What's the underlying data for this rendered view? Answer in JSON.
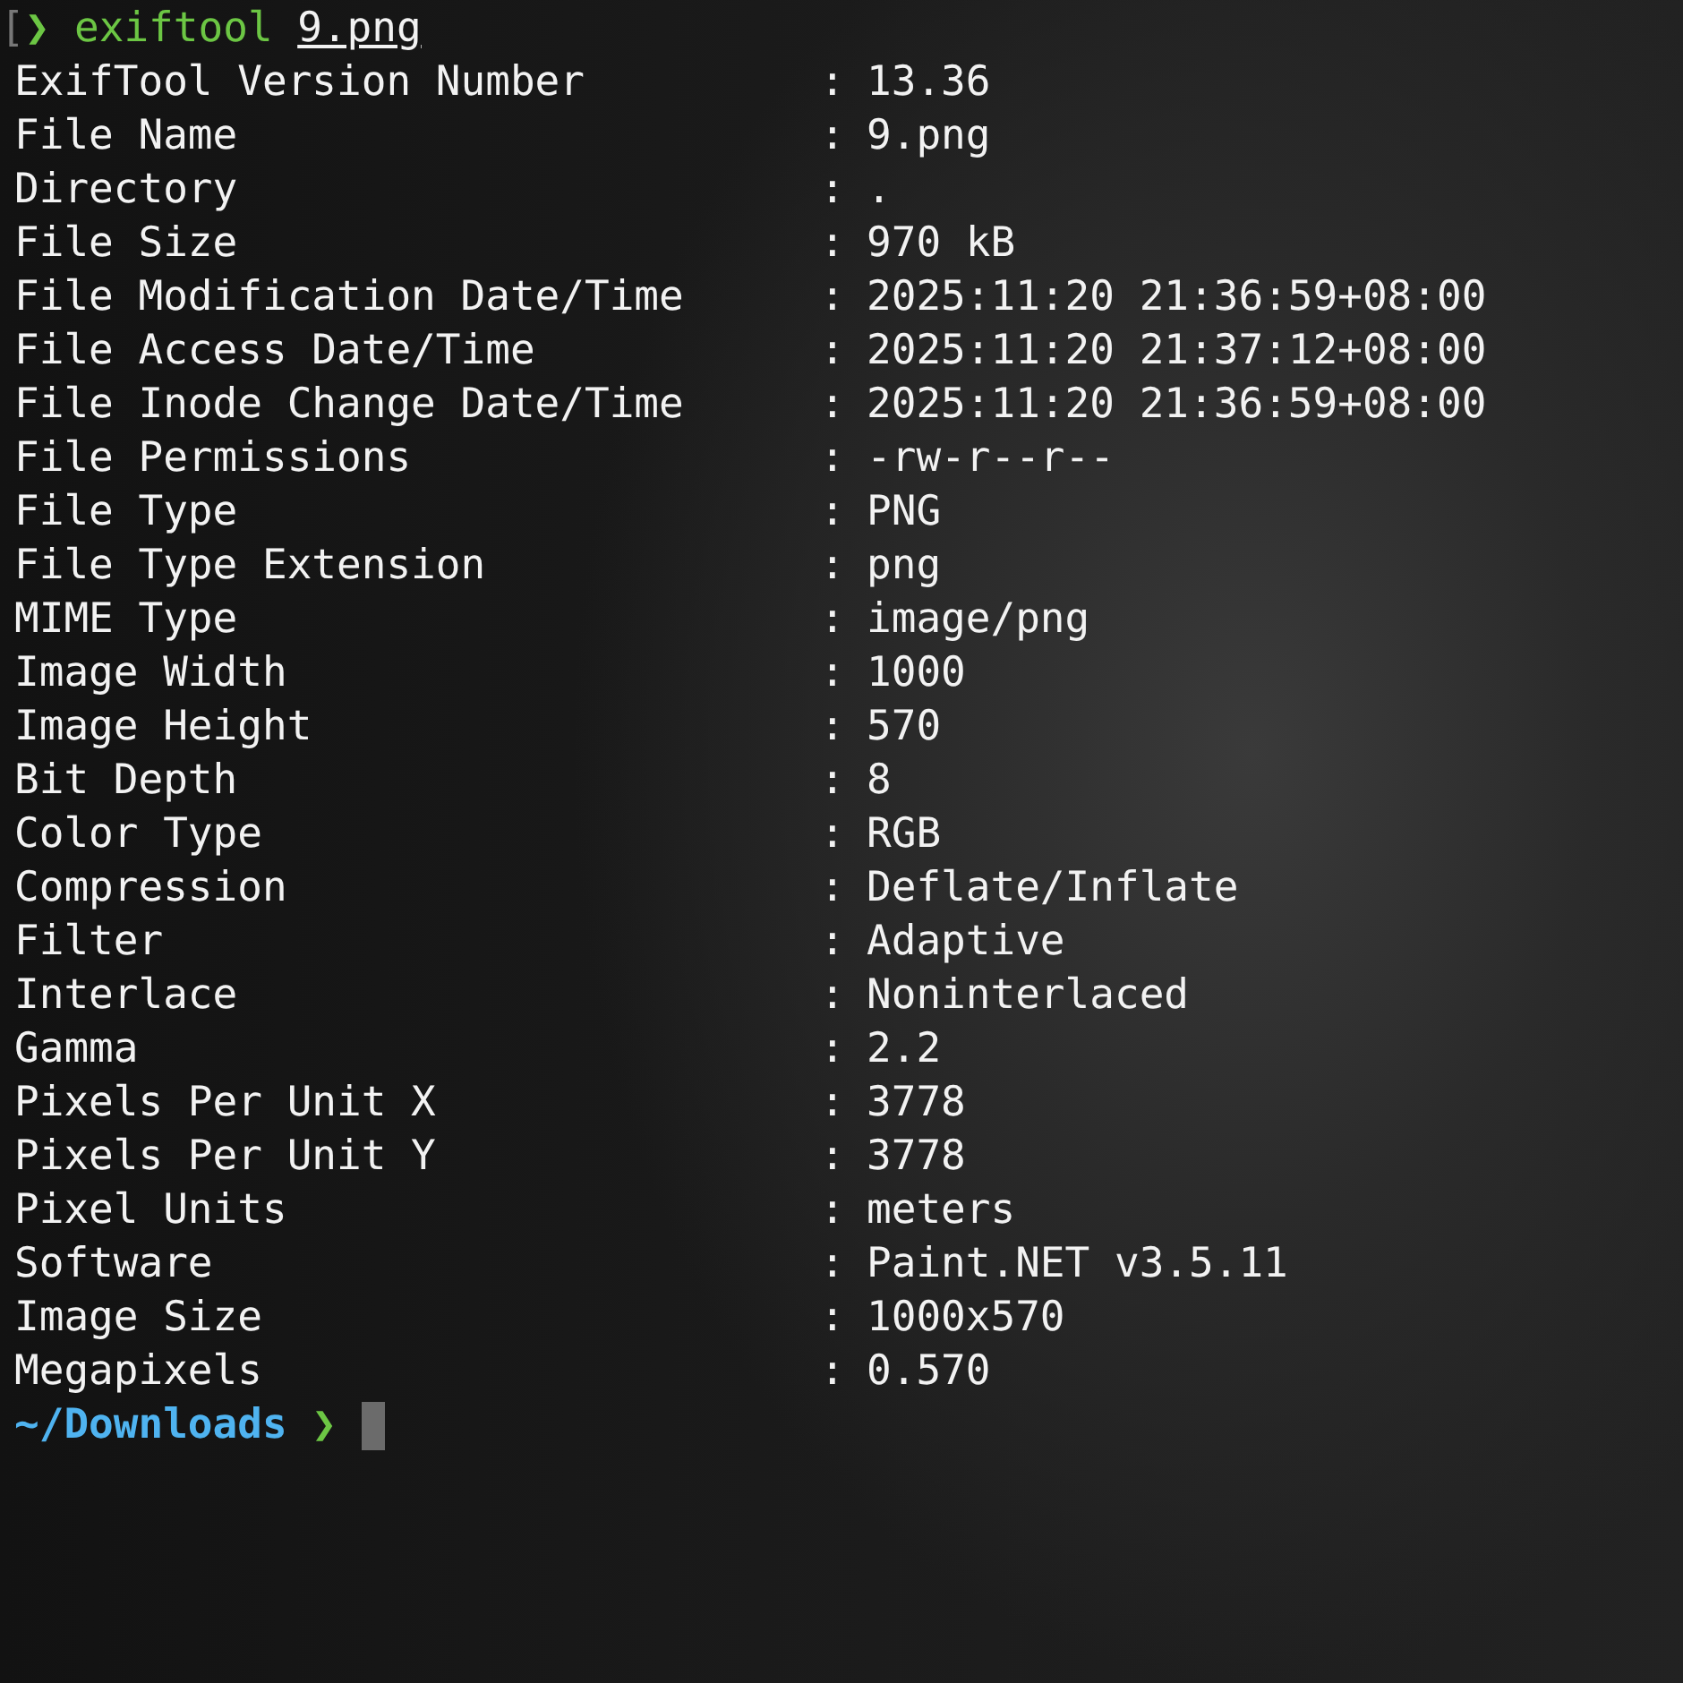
{
  "command_line": {
    "bracket": "[",
    "arrow": "❯",
    "command": "exiftool",
    "argument": "9.png"
  },
  "rows": [
    {
      "key": "ExifTool Version Number",
      "separator": ":",
      "value": "13.36"
    },
    {
      "key": "File Name",
      "separator": ":",
      "value": "9.png"
    },
    {
      "key": "Directory",
      "separator": ":",
      "value": "."
    },
    {
      "key": "File Size",
      "separator": ":",
      "value": "970 kB"
    },
    {
      "key": "File Modification Date/Time",
      "separator": ":",
      "value": "2025:11:20 21:36:59+08:00"
    },
    {
      "key": "File Access Date/Time",
      "separator": ":",
      "value": "2025:11:20 21:37:12+08:00"
    },
    {
      "key": "File Inode Change Date/Time",
      "separator": ":",
      "value": "2025:11:20 21:36:59+08:00"
    },
    {
      "key": "File Permissions",
      "separator": ":",
      "value": "-rw-r--r--"
    },
    {
      "key": "File Type",
      "separator": ":",
      "value": "PNG"
    },
    {
      "key": "File Type Extension",
      "separator": ":",
      "value": "png"
    },
    {
      "key": "MIME Type",
      "separator": ":",
      "value": "image/png"
    },
    {
      "key": "Image Width",
      "separator": ":",
      "value": "1000"
    },
    {
      "key": "Image Height",
      "separator": ":",
      "value": "570"
    },
    {
      "key": "Bit Depth",
      "separator": ":",
      "value": "8"
    },
    {
      "key": "Color Type",
      "separator": ":",
      "value": "RGB"
    },
    {
      "key": "Compression",
      "separator": ":",
      "value": "Deflate/Inflate"
    },
    {
      "key": "Filter",
      "separator": ":",
      "value": "Adaptive"
    },
    {
      "key": "Interlace",
      "separator": ":",
      "value": "Noninterlaced"
    },
    {
      "key": "Gamma",
      "separator": ":",
      "value": "2.2"
    },
    {
      "key": "Pixels Per Unit X",
      "separator": ":",
      "value": "3778"
    },
    {
      "key": "Pixels Per Unit Y",
      "separator": ":",
      "value": "3778"
    },
    {
      "key": "Pixel Units",
      "separator": ":",
      "value": "meters"
    },
    {
      "key": "Software",
      "separator": ":",
      "value": "Paint.NET v3.5.11"
    },
    {
      "key": "Image Size",
      "separator": ":",
      "value": "1000x570"
    },
    {
      "key": "Megapixels",
      "separator": ":",
      "value": "0.570"
    }
  ],
  "prompt": {
    "path": "~/Downloads",
    "arrow": "❯"
  }
}
